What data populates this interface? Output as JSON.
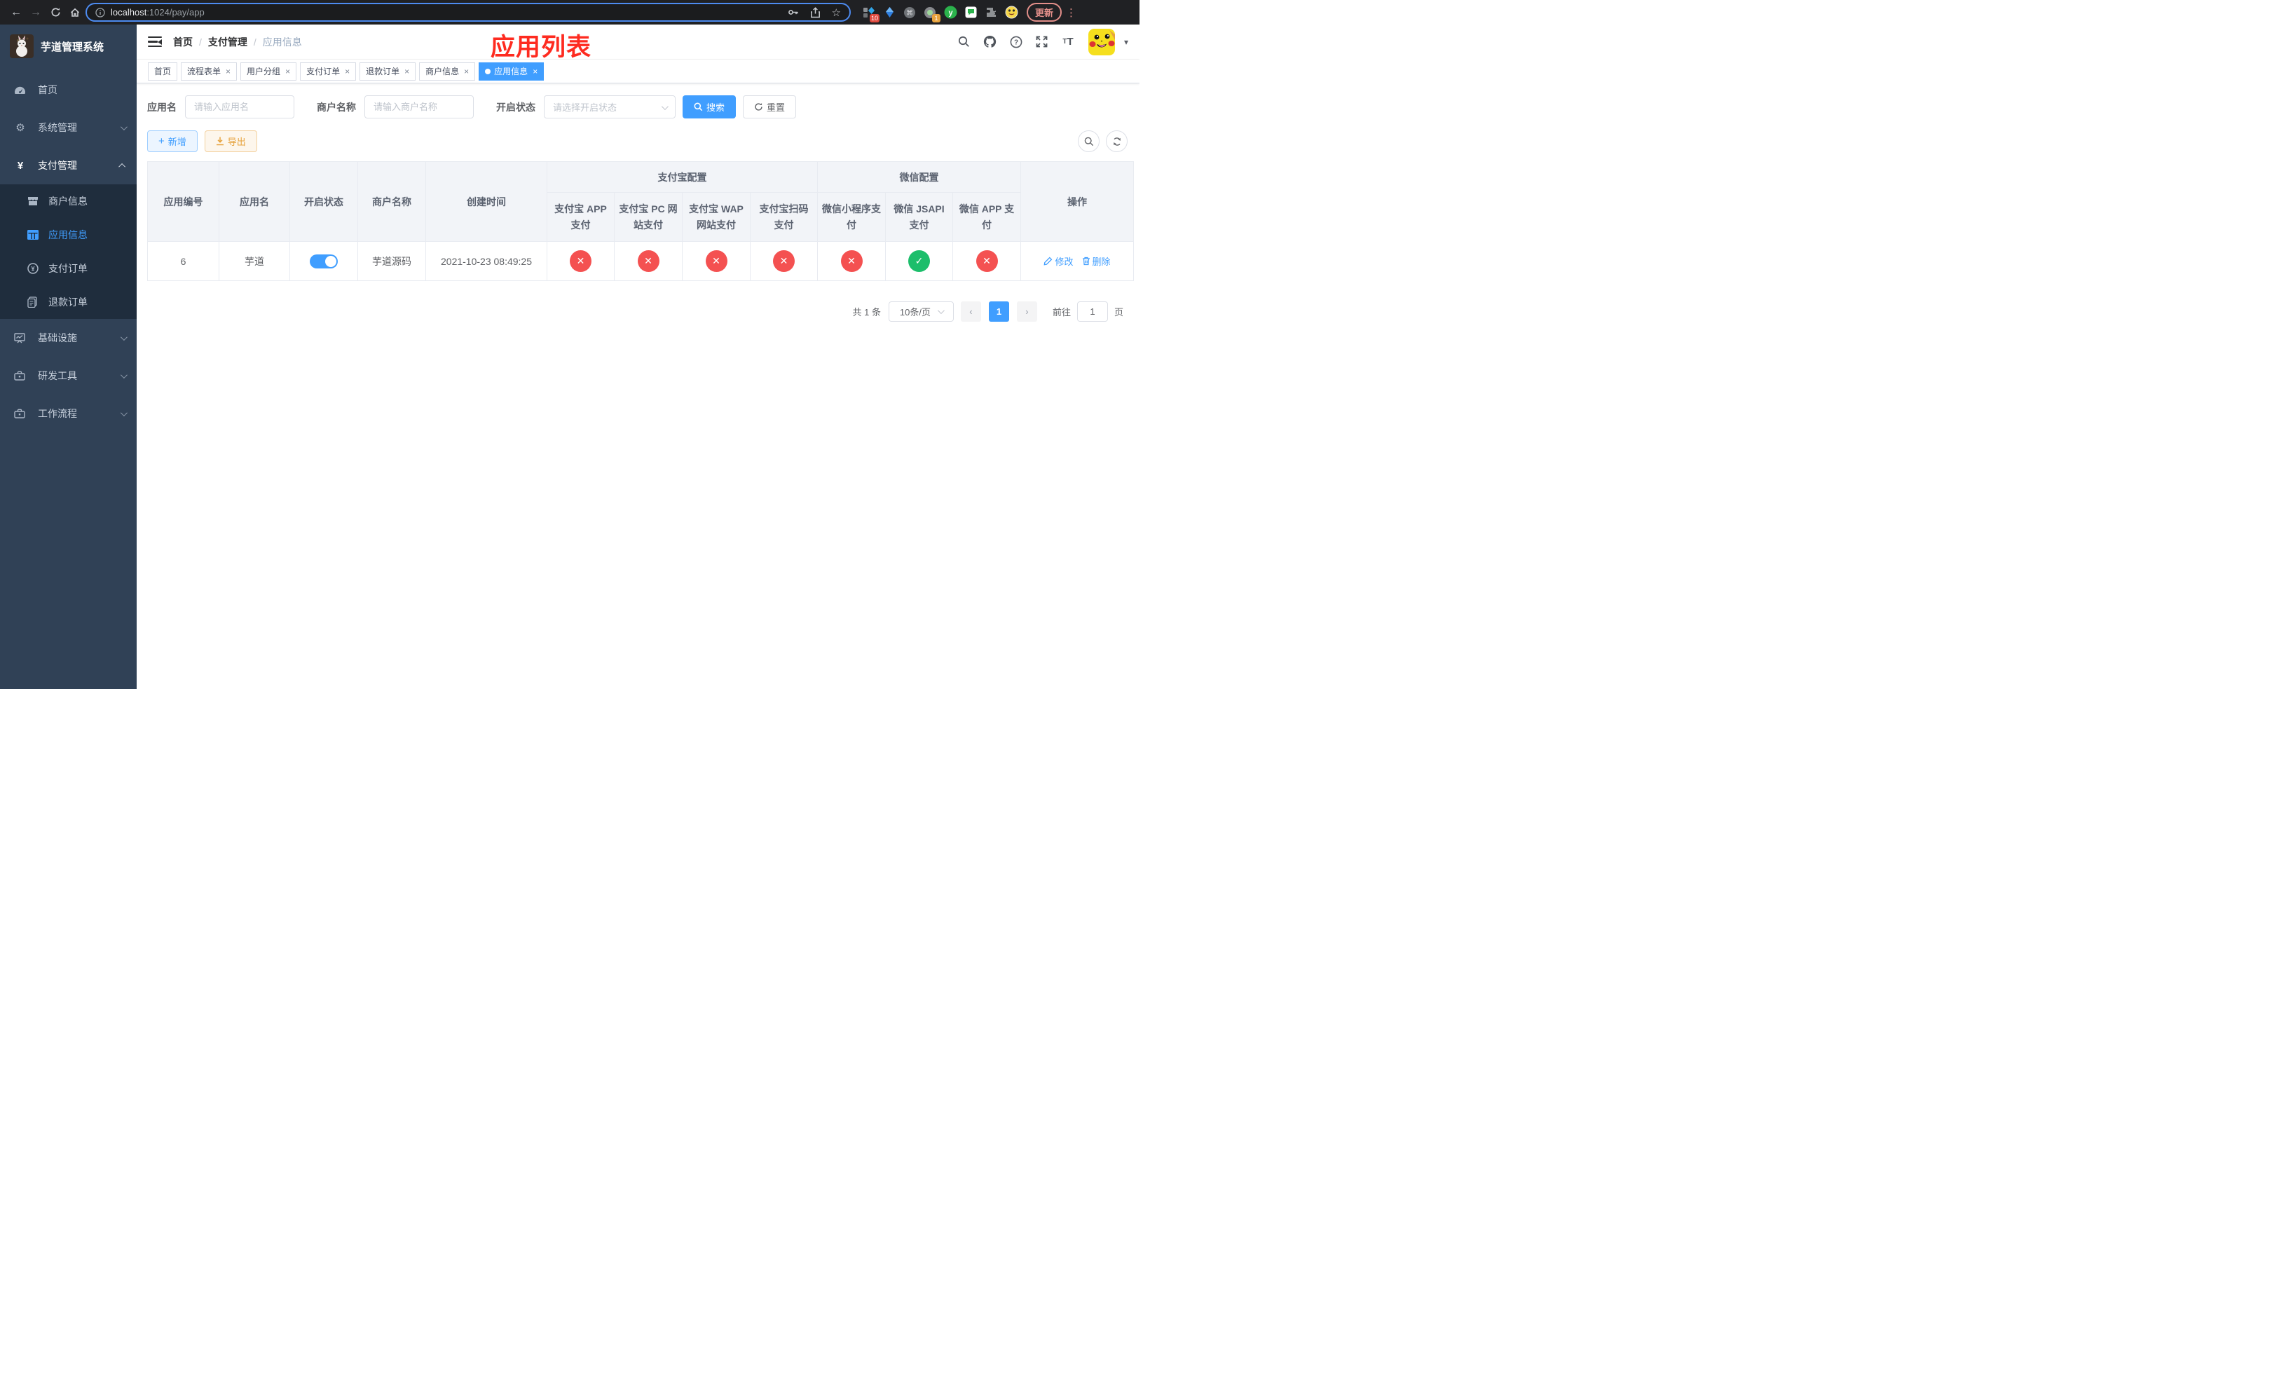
{
  "colors": {
    "accent": "#409eff",
    "danger": "#f45151",
    "success": "#1cbe6b",
    "sidebar_bg": "#304156",
    "submenu_bg": "#1f2d3d",
    "warning": "#e6a23c"
  },
  "browser": {
    "url_host": "localhost",
    "url_path": ":1024/pay/app",
    "update_label": "更新",
    "ext_badge_1": "10",
    "ext_badge_2": "1"
  },
  "sidebar": {
    "title": "芋道管理系统",
    "items": [
      {
        "label": "首页"
      },
      {
        "label": "系统管理"
      },
      {
        "label": "支付管理"
      },
      {
        "label": "基础设施"
      },
      {
        "label": "研发工具"
      },
      {
        "label": "工作流程"
      }
    ],
    "subitems": [
      {
        "label": "商户信息"
      },
      {
        "label": "应用信息"
      },
      {
        "label": "支付订单"
      },
      {
        "label": "退款订单"
      }
    ]
  },
  "navbar": {
    "breadcrumb": [
      "首页",
      "支付管理",
      "应用信息"
    ],
    "separator": "/"
  },
  "overlay_title": "应用列表",
  "tabs": [
    {
      "label": "首页"
    },
    {
      "label": "流程表单"
    },
    {
      "label": "用户分组"
    },
    {
      "label": "支付订单"
    },
    {
      "label": "退款订单"
    },
    {
      "label": "商户信息"
    },
    {
      "label": "应用信息"
    }
  ],
  "filters": {
    "app_name_label": "应用名",
    "app_name_placeholder": "请输入应用名",
    "merchant_label": "商户名称",
    "merchant_placeholder": "请输入商户名称",
    "status_label": "开启状态",
    "status_placeholder": "请选择开启状态",
    "search_label": "搜索",
    "reset_label": "重置"
  },
  "toolbar": {
    "add_label": "新增",
    "export_label": "导出"
  },
  "table": {
    "columns": [
      "应用编号",
      "应用名",
      "开启状态",
      "商户名称",
      "创建时间"
    ],
    "groups": [
      {
        "label": "支付宝配置",
        "children": [
          "支付宝 APP 支付",
          "支付宝 PC 网站支付",
          "支付宝 WAP 网站支付",
          "支付宝扫码支付"
        ]
      },
      {
        "label": "微信配置",
        "children": [
          "微信小程序支付",
          "微信 JSAPI 支付",
          "微信 APP 支付"
        ]
      }
    ],
    "ops_label": "操作",
    "icons": {
      "yes": "✓",
      "no": "✕"
    },
    "row": {
      "id": "6",
      "name": "芋道",
      "enabled": true,
      "merchant": "芋道源码",
      "created": "2021-10-23 08:49:25",
      "statuses": [
        false,
        false,
        false,
        false,
        false,
        true,
        false
      ],
      "edit_label": "修改",
      "delete_label": "删除"
    }
  },
  "pagination": {
    "total": "共 1 条",
    "page_size": "10条/页",
    "current": "1",
    "goto_label": "前往",
    "goto_value": "1",
    "unit_label": "页"
  }
}
